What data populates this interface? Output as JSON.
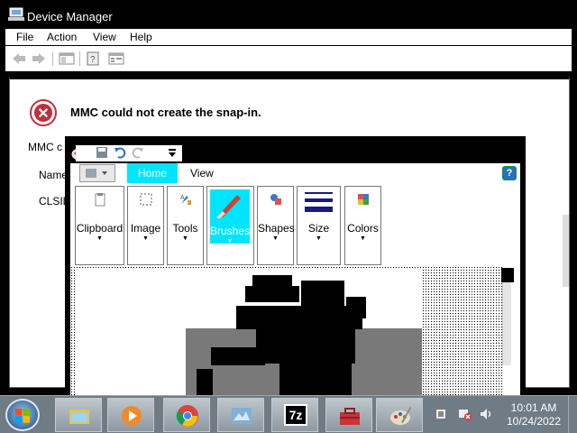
{
  "device_manager": {
    "title": "Device Manager",
    "menu": [
      "File",
      "Action",
      "View",
      "Help"
    ],
    "error_title": "MMC could not create the snap-in.",
    "detail_line_1": "MMC c",
    "detail_line_2": "Name",
    "detail_line_3": "CLSID"
  },
  "paint": {
    "tabs": {
      "home": "Home",
      "view": "View"
    },
    "help_glyph": "?",
    "groups": [
      {
        "label": "Clipboard",
        "icon": "clipboard-icon"
      },
      {
        "label": "Image",
        "icon": "image-select-icon"
      },
      {
        "label": "Tools",
        "icon": "tools-icon"
      },
      {
        "label": "Brushes",
        "icon": "brushes-icon"
      },
      {
        "label": "Shapes",
        "icon": "shapes-icon"
      },
      {
        "label": "Size",
        "icon": "size-icon"
      },
      {
        "label": "Colors",
        "icon": "colors-icon"
      }
    ],
    "selected_group": "Brushes"
  },
  "taskbar": {
    "apps": [
      "explorer-icon",
      "media-player-icon",
      "chrome-icon",
      "network-icon",
      "7zip-icon",
      "toolbox-icon",
      "paint-icon"
    ],
    "seven_zip_label": "7z",
    "clock_time": "10:01 AM",
    "clock_date": "10/24/2022"
  },
  "colors": {
    "accent_cyan": "#00e5ff",
    "taskbar": "#6f7b85",
    "error_red": "#c0303a"
  }
}
